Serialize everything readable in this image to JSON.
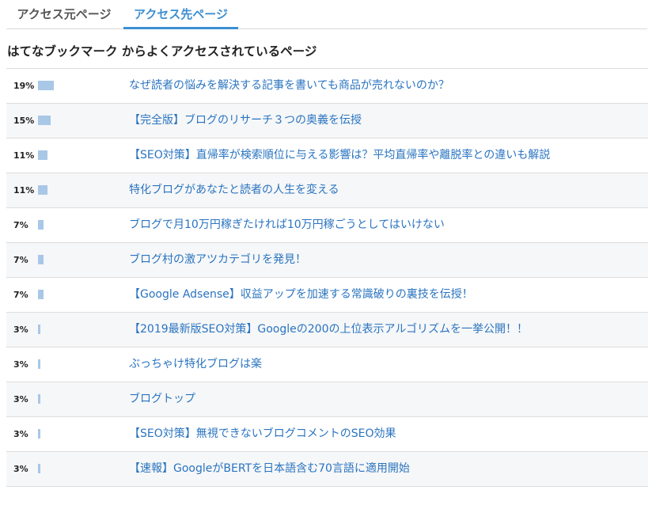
{
  "tabs": [
    {
      "label": "アクセス元ページ",
      "active": false
    },
    {
      "label": "アクセス先ページ",
      "active": true
    }
  ],
  "section_title": "はてなブックマーク からよくアクセスされているページ",
  "colors": {
    "accent": "#3d8fd0",
    "link": "#2a74c0",
    "bar": "#a9c7e6"
  },
  "rows": [
    {
      "percent_label": "19%",
      "percent": 19,
      "title": "なぜ読者の悩みを解決する記事を書いても商品が売れないのか？"
    },
    {
      "percent_label": "15%",
      "percent": 15,
      "title": "【完全版】ブログのリサーチ３つの奥義を伝授"
    },
    {
      "percent_label": "11%",
      "percent": 11,
      "title": "【SEO対策】直帰率が検索順位に与える影響は？平均直帰率や離脱率との違いも解説"
    },
    {
      "percent_label": "11%",
      "percent": 11,
      "title": "特化ブログがあなたと読者の人生を変える"
    },
    {
      "percent_label": "7%",
      "percent": 7,
      "title": "ブログで月10万円稼ぎたければ10万円稼ごうとしてはいけない"
    },
    {
      "percent_label": "7%",
      "percent": 7,
      "title": "ブログ村の激アツカテゴリを発見！"
    },
    {
      "percent_label": "7%",
      "percent": 7,
      "title": "【Google Adsense】収益アップを加速する常識破りの裏技を伝授！"
    },
    {
      "percent_label": "3%",
      "percent": 3,
      "title": "【2019最新版SEO対策】Googleの200の上位表示アルゴリズムを一挙公開！！"
    },
    {
      "percent_label": "3%",
      "percent": 3,
      "title": "ぶっちゃけ特化ブログは楽"
    },
    {
      "percent_label": "3%",
      "percent": 3,
      "title": "ブログトップ"
    },
    {
      "percent_label": "3%",
      "percent": 3,
      "title": "【SEO対策】無視できないブログコメントのSEO効果"
    },
    {
      "percent_label": "3%",
      "percent": 3,
      "title": "【速報】GoogleがBERTを日本語含む70言語に適用開始"
    }
  ]
}
